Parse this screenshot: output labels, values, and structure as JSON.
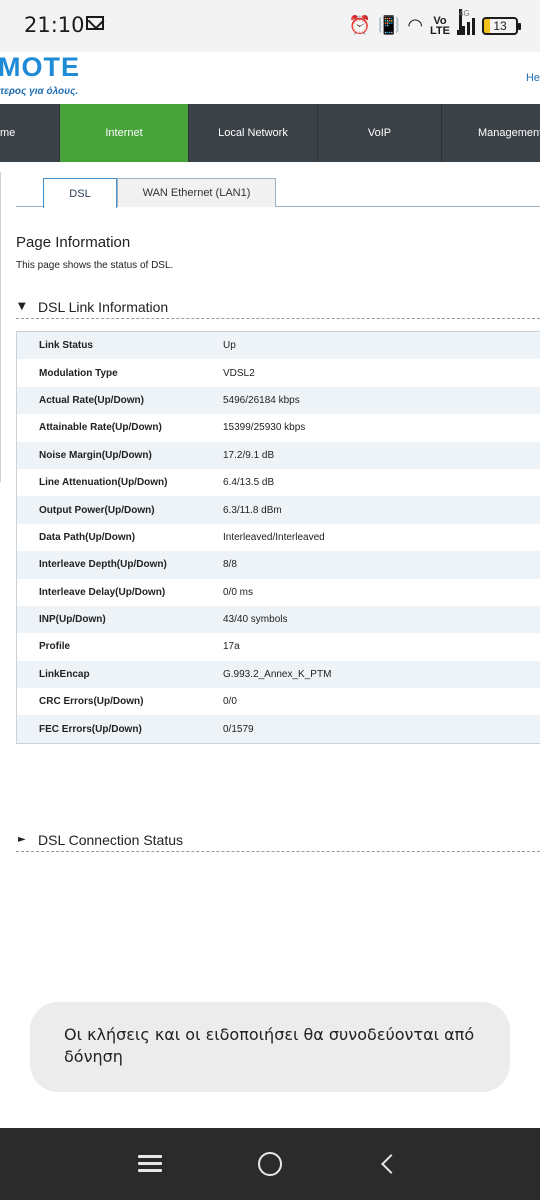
{
  "status_bar": {
    "time": "21:10",
    "network_top": "4G",
    "volte_line1": "Vo",
    "volte_line2": "LTE",
    "battery": "13"
  },
  "header": {
    "logo_text": "ΜΟΤΕ",
    "tagline": "τερος για όλους.",
    "help_link": "He"
  },
  "nav": {
    "items": [
      {
        "label": "me",
        "active": false
      },
      {
        "label": "Internet",
        "active": true
      },
      {
        "label": "Local Network",
        "active": false
      },
      {
        "label": "VoIP",
        "active": false
      },
      {
        "label": "Management",
        "active": false
      }
    ]
  },
  "tabs": [
    {
      "label": "DSL",
      "active": true
    },
    {
      "label": "WAN Ethernet (LAN1)",
      "active": false
    }
  ],
  "page_info": {
    "title": "Page Information",
    "description": "This page shows the status of DSL."
  },
  "sections": {
    "link_info": {
      "arrow": "▼",
      "title": "DSL Link Information"
    },
    "connection_status": {
      "arrow": "►",
      "title": "DSL Connection Status"
    }
  },
  "link_table": [
    {
      "label": "Link Status",
      "value": "Up"
    },
    {
      "label": "Modulation Type",
      "value": "VDSL2"
    },
    {
      "label": "Actual Rate(Up/Down)",
      "value": "5496/26184 kbps"
    },
    {
      "label": "Attainable Rate(Up/Down)",
      "value": "15399/25930 kbps"
    },
    {
      "label": "Noise Margin(Up/Down)",
      "value": "17.2/9.1 dB"
    },
    {
      "label": "Line Attenuation(Up/Down)",
      "value": "6.4/13.5 dB"
    },
    {
      "label": "Output Power(Up/Down)",
      "value": "6.3/11.8 dBm"
    },
    {
      "label": "Data Path(Up/Down)",
      "value": "Interleaved/Interleaved"
    },
    {
      "label": "Interleave Depth(Up/Down)",
      "value": "8/8"
    },
    {
      "label": "Interleave Delay(Up/Down)",
      "value": "0/0 ms"
    },
    {
      "label": "INP(Up/Down)",
      "value": "43/40 symbols"
    },
    {
      "label": "Profile",
      "value": "17a"
    },
    {
      "label": "LinkEncap",
      "value": "G.993.2_Annex_K_PTM"
    },
    {
      "label": "CRC Errors(Up/Down)",
      "value": "0/0"
    },
    {
      "label": "FEC Errors(Up/Down)",
      "value": "0/1579"
    }
  ],
  "toast": {
    "message": "Οι κλήσεις και οι ειδοποιήσει θα συνοδεύονται από δόνηση"
  }
}
